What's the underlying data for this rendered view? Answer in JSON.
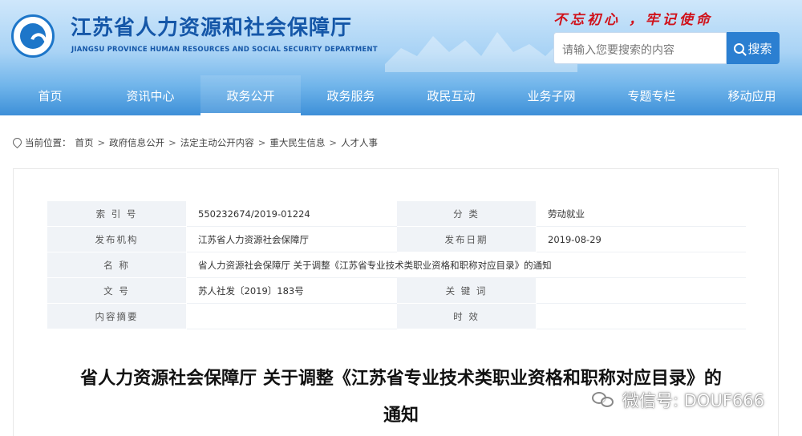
{
  "header": {
    "title": "江苏省人力资源和社会保障厅",
    "subtitle": "JIANGSU PROVINCE HUMAN RESOURCES AND SOCIAL SECURITY DEPARTMENT",
    "slogan": "不忘初心 ，牢记使命",
    "search_placeholder": "请输入您要搜索的内容",
    "search_button": "搜索"
  },
  "nav": {
    "items": [
      "首页",
      "资讯中心",
      "政务公开",
      "政务服务",
      "政民互动",
      "业务子网",
      "专题专栏",
      "移动应用"
    ],
    "active": "政务公开"
  },
  "breadcrumb": {
    "prefix": "当前位置：",
    "items": [
      "首页",
      "政府信息公开",
      "法定主动公开内容",
      "重大民生信息",
      "人才人事"
    ],
    "separator": ">"
  },
  "info": {
    "index_label": "索 引 号",
    "index_value": "550232674/2019-01224",
    "category_label": "分 类",
    "category_value": "劳动就业",
    "publisher_label": "发布机构",
    "publisher_value": "江苏省人力资源社会保障厅",
    "date_label": "发布日期",
    "date_value": "2019-08-29",
    "name_label": "名 称",
    "name_value": "省人力资源社会保障厅 关于调整《江苏省专业技术类职业资格和职称对应目录》的通知",
    "docno_label": "文 号",
    "docno_value": "苏人社发〔2019〕183号",
    "keyword_label": "关 键 词",
    "keyword_value": "",
    "summary_label": "内容摘要",
    "summary_value": "",
    "validity_label": "时 效",
    "validity_value": ""
  },
  "document": {
    "title_line1": "省人力资源社会保障厅 关于调整《江苏省专业技术类职业资格和职称对应目录》的",
    "title_line2": "通知"
  },
  "watermark": {
    "text": "微信号: DOUF666"
  }
}
